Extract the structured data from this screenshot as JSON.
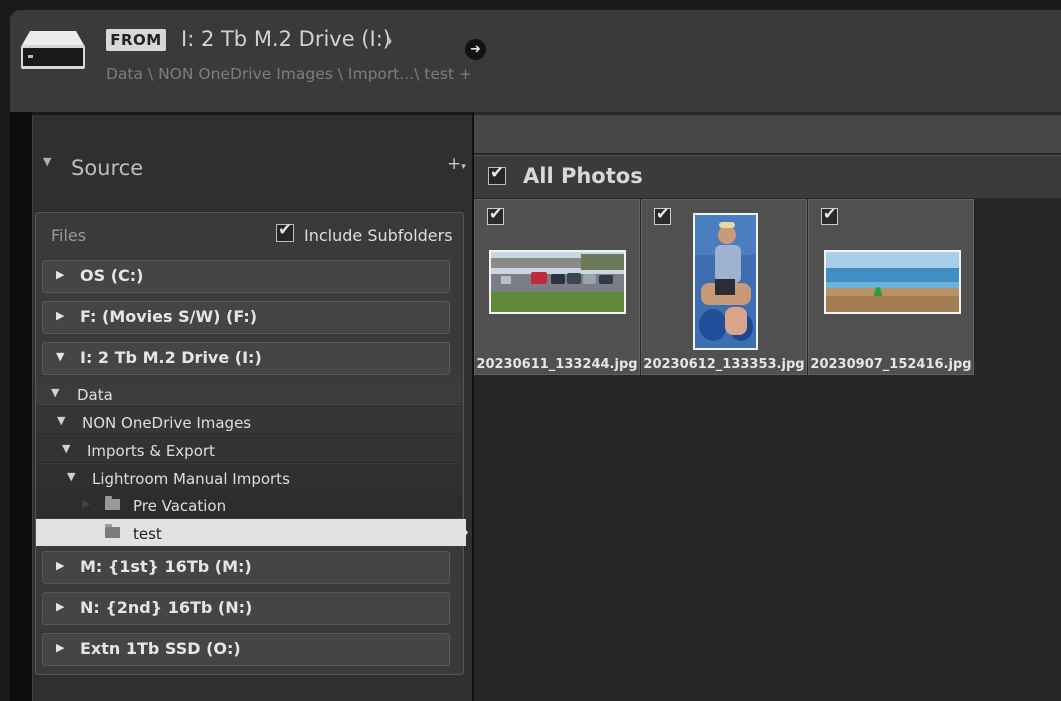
{
  "header": {
    "from_label": "FROM",
    "source_drive": "I: 2 Tb M.2 Drive (I:)",
    "path": "Data \\ NON OneDrive Images \\ Import...\\ test +",
    "drive_icon": "hard-drive-icon",
    "go_icon": "arrow-right-icon"
  },
  "source_panel": {
    "title": "Source",
    "files_label": "Files",
    "include_subfolders_label": "Include Subfolders",
    "include_subfolders_checked": true
  },
  "volumes": [
    {
      "label": "OS (C:)",
      "expanded": false
    },
    {
      "label": "F: (Movies S/W) (F:)",
      "expanded": false
    },
    {
      "label": "I: 2 Tb M.2 Drive (I:)",
      "expanded": true
    },
    {
      "label": "M: {1st} 16Tb (M:)",
      "expanded": false
    },
    {
      "label": "N: {2nd} 16Tb (N:)",
      "expanded": false
    },
    {
      "label": "Extn 1Tb SSD (O:)",
      "expanded": false
    }
  ],
  "folders": [
    {
      "label": "Data",
      "selected": false
    },
    {
      "label": "NON OneDrive Images",
      "selected": false
    },
    {
      "label": "Imports & Export",
      "selected": false
    },
    {
      "label": "Lightroom Manual Imports",
      "selected": false
    },
    {
      "label": "Pre Vacation",
      "selected": false
    },
    {
      "label": "test",
      "selected": true
    }
  ],
  "grid": {
    "title": "All Photos",
    "all_checked": true,
    "photos": [
      {
        "filename": "20230611_133244.jpg",
        "checked": true
      },
      {
        "filename": "20230612_133353.jpg",
        "checked": true
      },
      {
        "filename": "20230907_152416.jpg",
        "checked": true
      }
    ]
  }
}
